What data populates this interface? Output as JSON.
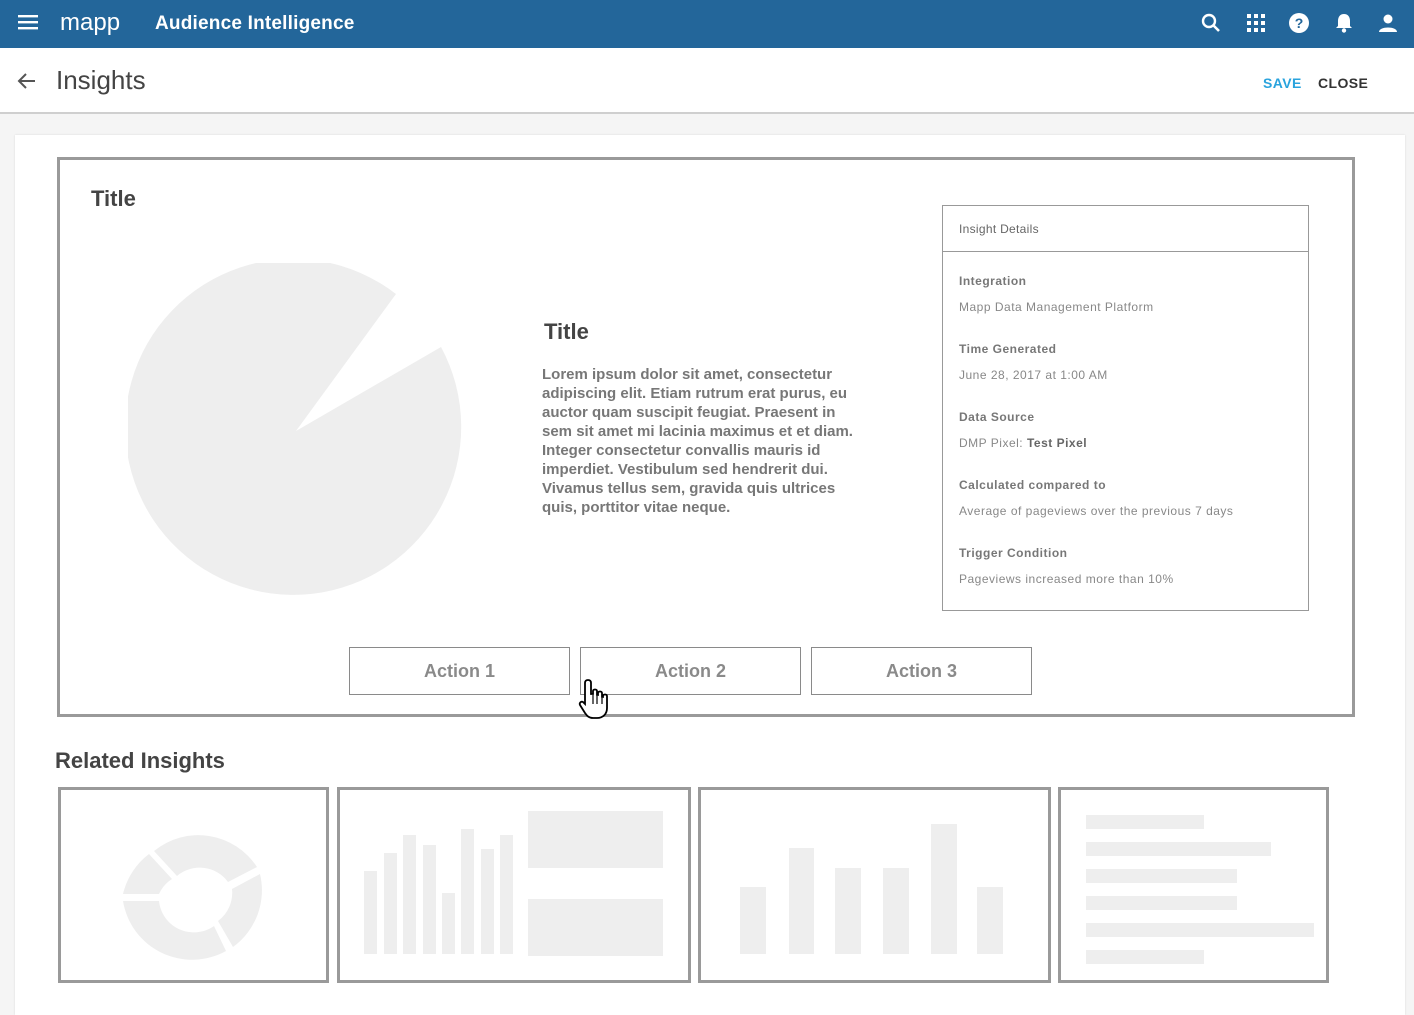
{
  "header": {
    "logo_text": "mapp",
    "app_title": "Audience Intelligence",
    "icons": [
      "menu-icon",
      "search-icon",
      "apps-grid-icon",
      "help-icon",
      "notifications-icon",
      "account-icon"
    ],
    "bar_color": "#23669a"
  },
  "subheader": {
    "page_title": "Insights",
    "save_label": "SAVE",
    "close_label": "CLOSE",
    "save_color": "#29a3dd"
  },
  "insight": {
    "title": "Title",
    "center_title": "Title",
    "body": "Lorem ipsum dolor sit amet, consectetur adipiscing elit. Etiam rutrum erat purus, eu auctor quam suscipit feugiat. Praesent in sem sit amet mi lacinia maximus et et diam. Integer consectetur convallis mauris id imperdiet. Vestibulum sed hendrerit dui. Vivamus tellus sem, gravida quis ultrices quis, porttitor vitae neque.",
    "details": {
      "heading": "Insight Details",
      "integration_label": "Integration",
      "integration_value": "Mapp Data Management Platform",
      "time_label": "Time Generated",
      "time_value": "June 28, 2017 at 1:00 AM",
      "source_label": "Data Source",
      "source_prefix": "DMP Pixel: ",
      "source_value": "Test Pixel",
      "compared_label": "Calculated compared to",
      "compared_value": "Average of pageviews over the previous 7 days",
      "trigger_label": "Trigger Condition",
      "trigger_value": "Pageviews increased more than 10%"
    },
    "actions": [
      "Action 1",
      "Action 2",
      "Action 3"
    ]
  },
  "related": {
    "title": "Related Insights"
  },
  "placeholder_color": "#eeeeee"
}
